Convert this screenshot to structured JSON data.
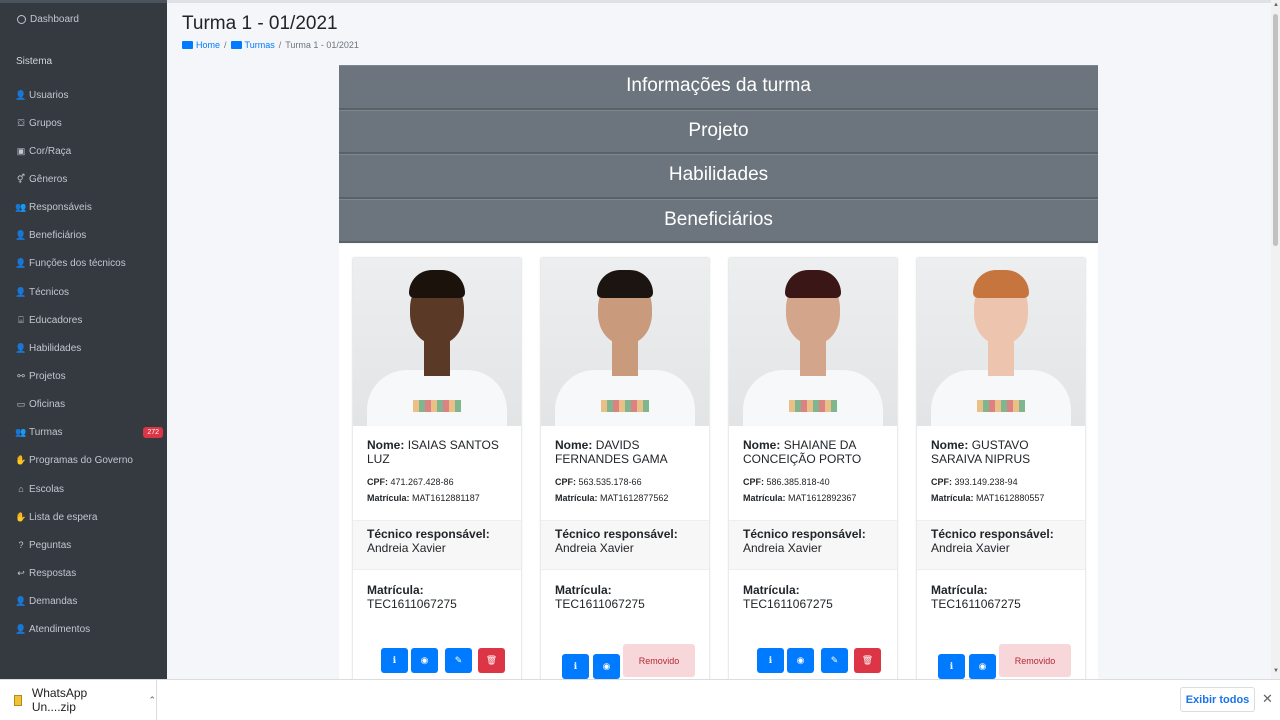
{
  "sidebar": {
    "dashboard": "Dashboard",
    "section": "Sistema",
    "items": [
      {
        "label": "Usuarios",
        "icon": "user-icon",
        "glyph": "👤"
      },
      {
        "label": "Grupos",
        "icon": "group-icon",
        "glyph": "⛋"
      },
      {
        "label": "Cor/Raça",
        "icon": "palette-icon",
        "glyph": "▣"
      },
      {
        "label": "Gêneros",
        "icon": "gender-icon",
        "glyph": "⚥"
      },
      {
        "label": "Responsáveis",
        "icon": "users-icon",
        "glyph": "👥"
      },
      {
        "label": "Beneficiários",
        "icon": "user-graduate-icon",
        "glyph": "👤"
      },
      {
        "label": "Funções dos técnicos",
        "icon": "user-cog-icon",
        "glyph": "👤"
      },
      {
        "label": "Técnicos",
        "icon": "user-tie-icon",
        "glyph": "👤"
      },
      {
        "label": "Educadores",
        "icon": "chalkboard-icon",
        "glyph": "⌸"
      },
      {
        "label": "Habilidades",
        "icon": "user-check-icon",
        "glyph": "👤"
      },
      {
        "label": "Projetos",
        "icon": "project-diagram-icon",
        "glyph": "⚯"
      },
      {
        "label": "Oficinas",
        "icon": "laptop-icon",
        "glyph": "▭"
      },
      {
        "label": "Turmas",
        "icon": "users-class-icon",
        "glyph": "👥",
        "badge": "272"
      },
      {
        "label": "Programas do Governo",
        "icon": "handshake-icon",
        "glyph": "✋"
      },
      {
        "label": "Escolas",
        "icon": "school-icon",
        "glyph": "⌂"
      },
      {
        "label": "Lista de espera",
        "icon": "hands-icon",
        "glyph": "✋"
      },
      {
        "label": "Peguntas",
        "icon": "question-icon",
        "glyph": "?"
      },
      {
        "label": "Respostas",
        "icon": "reply-icon",
        "glyph": "↩"
      },
      {
        "label": "Demandas",
        "icon": "user-demand-icon",
        "glyph": "👤"
      },
      {
        "label": "Atendimentos",
        "icon": "user-service-icon",
        "glyph": "👤"
      }
    ]
  },
  "page": {
    "title": "Turma 1 - 01/2021",
    "breadcrumb": {
      "home": "Home",
      "turmas": "Turmas",
      "current": "Turma 1 - 01/2021",
      "sep": "/"
    }
  },
  "accordion": [
    "Informações da turma",
    "Projeto",
    "Habilidades",
    "Beneficiários"
  ],
  "labels": {
    "nome": "Nome:",
    "cpf": "CPF:",
    "matricula_small": "Matrícula:",
    "tecnico": "Técnico responsável:",
    "matricula": "Matrícula:",
    "removido": "Removido"
  },
  "beneficiarios": [
    {
      "nome": "ISAIAS SANTOS LUZ",
      "cpf": "471.267.428-86",
      "matricula": "MAT1612881187",
      "tecnico": "Andreia Xavier",
      "tec_matricula": "TEC1611067275",
      "removido": false,
      "skin": "#5a3a26",
      "hair": "#1b120c"
    },
    {
      "nome": "DAVIDS FERNANDES GAMA",
      "cpf": "563.535.178-66",
      "matricula": "MAT1612877562",
      "tecnico": "Andreia Xavier",
      "tec_matricula": "TEC1611067275",
      "removido": true,
      "skin": "#c99a7c",
      "hair": "#1c1410"
    },
    {
      "nome": "SHAIANE DA CONCEIÇÃO PORTO",
      "cpf": "586.385.818-40",
      "matricula": "MAT1612892367",
      "tecnico": "Andreia Xavier",
      "tec_matricula": "TEC1611067275",
      "removido": false,
      "skin": "#d3a58a",
      "hair": "#3a1716"
    },
    {
      "nome": "GUSTAVO SARAIVA NIPRUS",
      "cpf": "393.149.238-94",
      "matricula": "MAT1612880557",
      "tecnico": "Andreia Xavier",
      "tec_matricula": "TEC1611067275",
      "removido": true,
      "skin": "#edc4ad",
      "hair": "#c7753f"
    }
  ],
  "downloads": {
    "file": "WhatsApp Un....zip",
    "show_all": "Exibir todos",
    "close": "✕"
  }
}
